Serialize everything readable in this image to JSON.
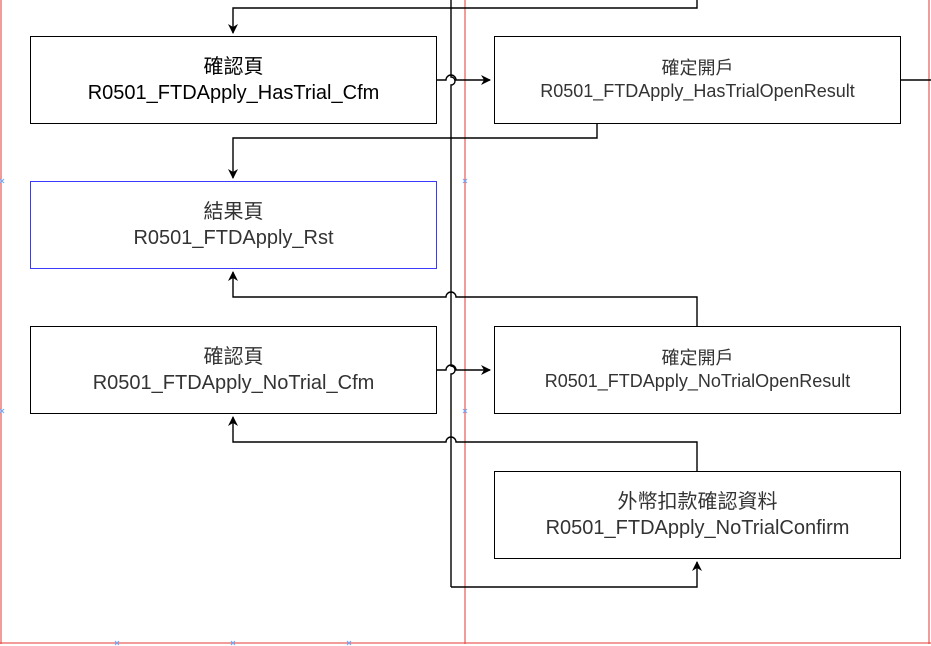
{
  "diagram": {
    "lane_border_color": "#e53935",
    "selected_border_color": "#3a3aff",
    "nodes": {
      "has_trial_cfm": {
        "title": "確認頁",
        "id": "R0501_FTDApply_HasTrial_Cfm"
      },
      "has_trial_open_result": {
        "title": "確定開戶",
        "id": "R0501_FTDApply_HasTrialOpenResult"
      },
      "rst": {
        "title": "結果頁",
        "id": "R0501_FTDApply_Rst"
      },
      "no_trial_cfm": {
        "title": "確認頁",
        "id": "R0501_FTDApply_NoTrial_Cfm"
      },
      "no_trial_open_result": {
        "title": "確定開戶",
        "id": "R0501_FTDApply_NoTrialOpenResult"
      },
      "no_trial_confirm": {
        "title": "外幣扣款確認資料",
        "id": "R0501_FTDApply_NoTrialConfirm"
      }
    }
  }
}
